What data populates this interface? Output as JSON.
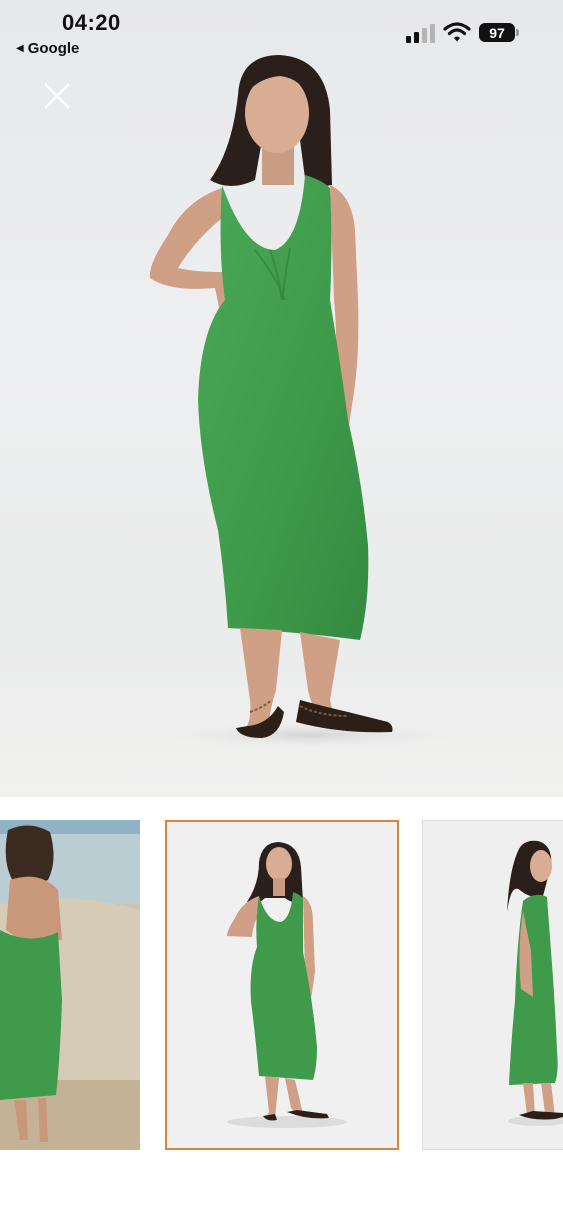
{
  "status_bar": {
    "time": "04:20",
    "back_label": "Google",
    "battery_level": "97",
    "signal_icon": "cellular-signal-icon",
    "wifi_icon": "wifi-icon"
  },
  "viewer": {
    "close_icon": "close-icon",
    "main_image_alt": "Model wearing green knit halter midi dress with sandals"
  },
  "thumbnails": {
    "items": [
      {
        "alt": "Back view of green halter dress on beach",
        "selected": false
      },
      {
        "alt": "Front view of green halter midi dress",
        "selected": true
      },
      {
        "alt": "Side view of green halter midi dress",
        "selected": false
      }
    ],
    "selected_border_color": "#d8843c"
  },
  "colors": {
    "dress_green": "#3f9a4c",
    "background": "#ffffff"
  }
}
